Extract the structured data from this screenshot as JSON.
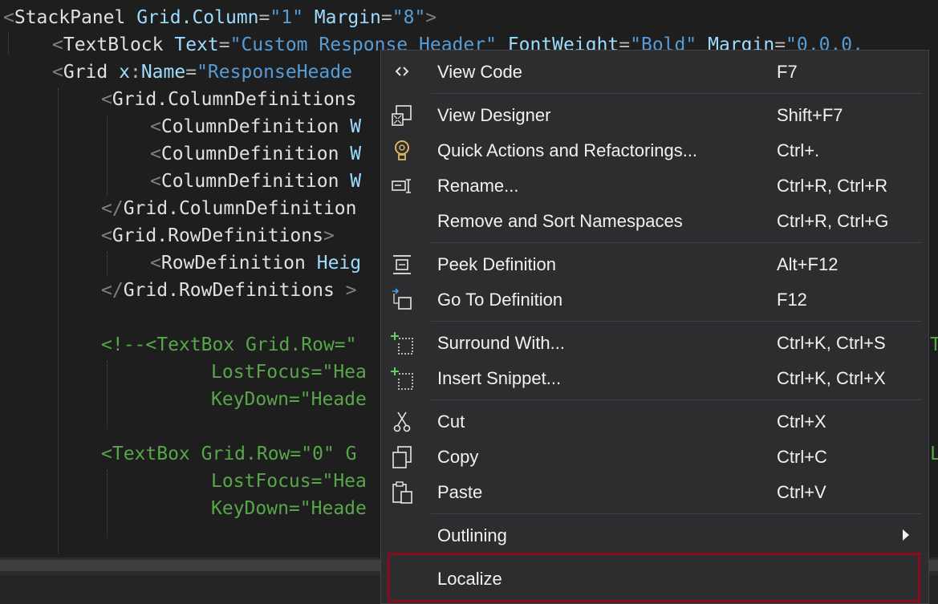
{
  "code": {
    "l1": {
      "open": "<",
      "tag": "StackPanel",
      "a1": "Grid.Column",
      "eq": "=",
      "v1": "\"1\"",
      "a2": "Margin",
      "v2": "\"8\"",
      "close": ">"
    },
    "l2": {
      "open": "<",
      "tag": "TextBlock",
      "a1": "Text",
      "eq": "=",
      "v1": "\"Custom Response Header\"",
      "a2": "FontWeight",
      "v2": "\"Bold\"",
      "a3": "Margin",
      "v3": "\"0,0,0,"
    },
    "l3": {
      "open": "<",
      "tag": "Grid",
      "a1pre": "x",
      ":": ":",
      "a1": "Name",
      "eq": "=",
      "v1": "\"ResponseHeade"
    },
    "l4": {
      "open": "<",
      "tag": "Grid.ColumnDefinitions"
    },
    "l5": {
      "open": "<",
      "tag": "ColumnDefinition",
      "a1": "W"
    },
    "l6": {
      "open": "<",
      "tag": "ColumnDefinition",
      "a1": "W"
    },
    "l7": {
      "open": "<",
      "tag": "ColumnDefinition",
      "a1": "W"
    },
    "l8": {
      "open": "</",
      "tag": "Grid.ColumnDefinition"
    },
    "l9": {
      "open": "<",
      "tag": "Grid.RowDefinitions",
      "close": ">"
    },
    "l10": {
      "open": "<",
      "tag": "RowDefinition",
      "a1": "Heig"
    },
    "l11": {
      "open": "</",
      "tag": "Grid.RowDefinitions",
      "close": ">"
    },
    "l13": "<!--<TextBox Grid.Row=\"",
    "l14": "LostFocus=\"Hea",
    "l15": "KeyDown=\"Heade",
    "l17": "<TextBox Grid.Row=\"0\" G",
    "l18": "LostFocus=\"Hea",
    "l19": "KeyDown=\"Heade",
    "r13": "T",
    "r17": "L"
  },
  "menu": {
    "items": [
      {
        "icon": "code-icon",
        "label": "View Code",
        "shortcut": "F7"
      },
      {
        "icon": "designer-icon",
        "label": "View Designer",
        "shortcut": "Shift+F7"
      },
      {
        "icon": "lightbulb-icon",
        "label": "Quick Actions and Refactorings...",
        "shortcut": "Ctrl+."
      },
      {
        "icon": "rename-icon",
        "label": "Rename...",
        "shortcut": "Ctrl+R, Ctrl+R"
      },
      {
        "icon": "",
        "label": "Remove and Sort Namespaces",
        "shortcut": "Ctrl+R, Ctrl+G"
      },
      {
        "icon": "peek-definition-icon",
        "label": "Peek Definition",
        "shortcut": "Alt+F12"
      },
      {
        "icon": "go-to-definition-icon",
        "label": "Go To Definition",
        "shortcut": "F12"
      },
      {
        "icon": "surround-with-icon",
        "label": "Surround With...",
        "shortcut": "Ctrl+K, Ctrl+S"
      },
      {
        "icon": "insert-snippet-icon",
        "label": "Insert Snippet...",
        "shortcut": "Ctrl+K, Ctrl+X"
      },
      {
        "icon": "cut-icon",
        "label": "Cut",
        "shortcut": "Ctrl+X"
      },
      {
        "icon": "copy-icon",
        "label": "Copy",
        "shortcut": "Ctrl+C"
      },
      {
        "icon": "paste-icon",
        "label": "Paste",
        "shortcut": "Ctrl+V"
      },
      {
        "icon": "",
        "label": "Outlining",
        "shortcut": "",
        "submenu": true
      },
      {
        "icon": "",
        "label": "Localize",
        "shortcut": "",
        "highlighted": true
      }
    ],
    "highlight_color": "#8b0a1d",
    "background": "#2d2d30"
  }
}
